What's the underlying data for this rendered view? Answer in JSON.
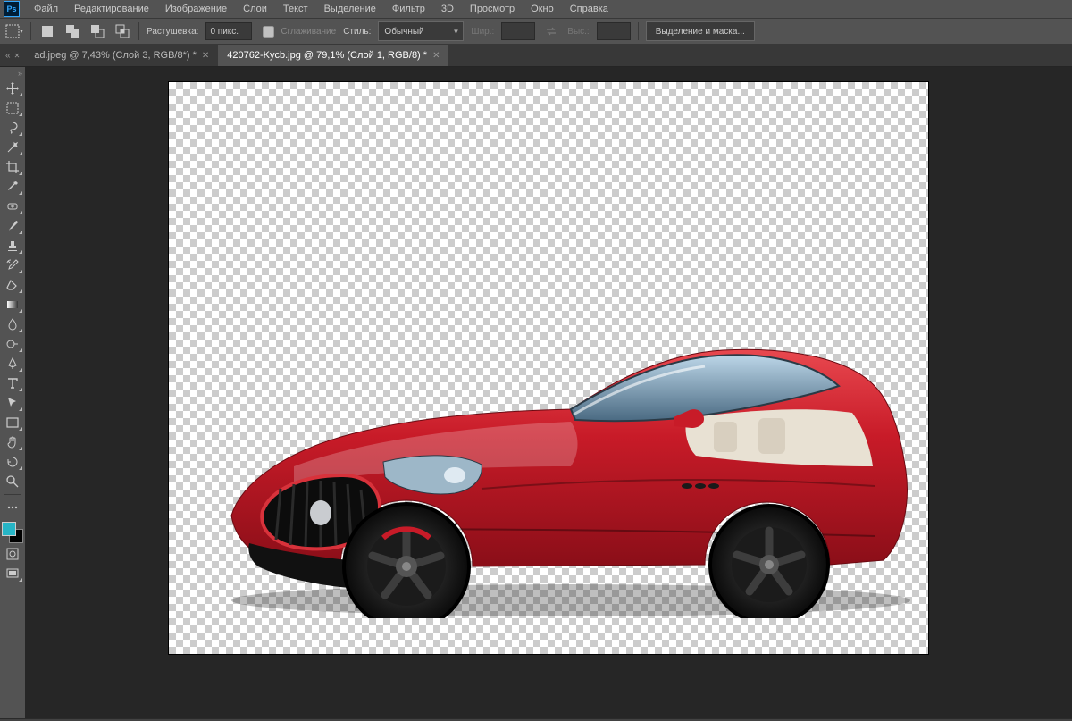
{
  "menu": {
    "items": [
      "Файл",
      "Редактирование",
      "Изображение",
      "Слои",
      "Текст",
      "Выделение",
      "Фильтр",
      "3D",
      "Просмотр",
      "Окно",
      "Справка"
    ]
  },
  "options": {
    "feather_label": "Растушевка:",
    "feather_value": "0 пикс.",
    "antialias": "Сглаживание",
    "style_label": "Стиль:",
    "style_value": "Обычный",
    "width_label": "Шир.:",
    "width_value": "",
    "height_label": "Выс.:",
    "height_value": "",
    "select_mask": "Выделение и маска..."
  },
  "tabs": [
    {
      "label": "ad.jpeg @ 7,43% (Слой 3, RGB/8*) *",
      "active": false
    },
    {
      "label": "420762-Kycb.jpg @ 79,1% (Слой 1, RGB/8) *",
      "active": true
    }
  ],
  "pin": "«",
  "colors": {
    "fg": "#26b5c6",
    "bg": "#000000",
    "canvas_bg": "#262626"
  },
  "tools": [
    "move",
    "marquee",
    "lasso",
    "magic-wand",
    "crop",
    "eyedropper",
    "heal",
    "brush",
    "stamp",
    "history",
    "eraser",
    "gradient",
    "blur",
    "dodge",
    "pen",
    "type",
    "path-select",
    "rectangle",
    "hand",
    "rotate",
    "zoom",
    "edit-toolbar"
  ],
  "canvas_content": "red convertible sports car on transparent background"
}
